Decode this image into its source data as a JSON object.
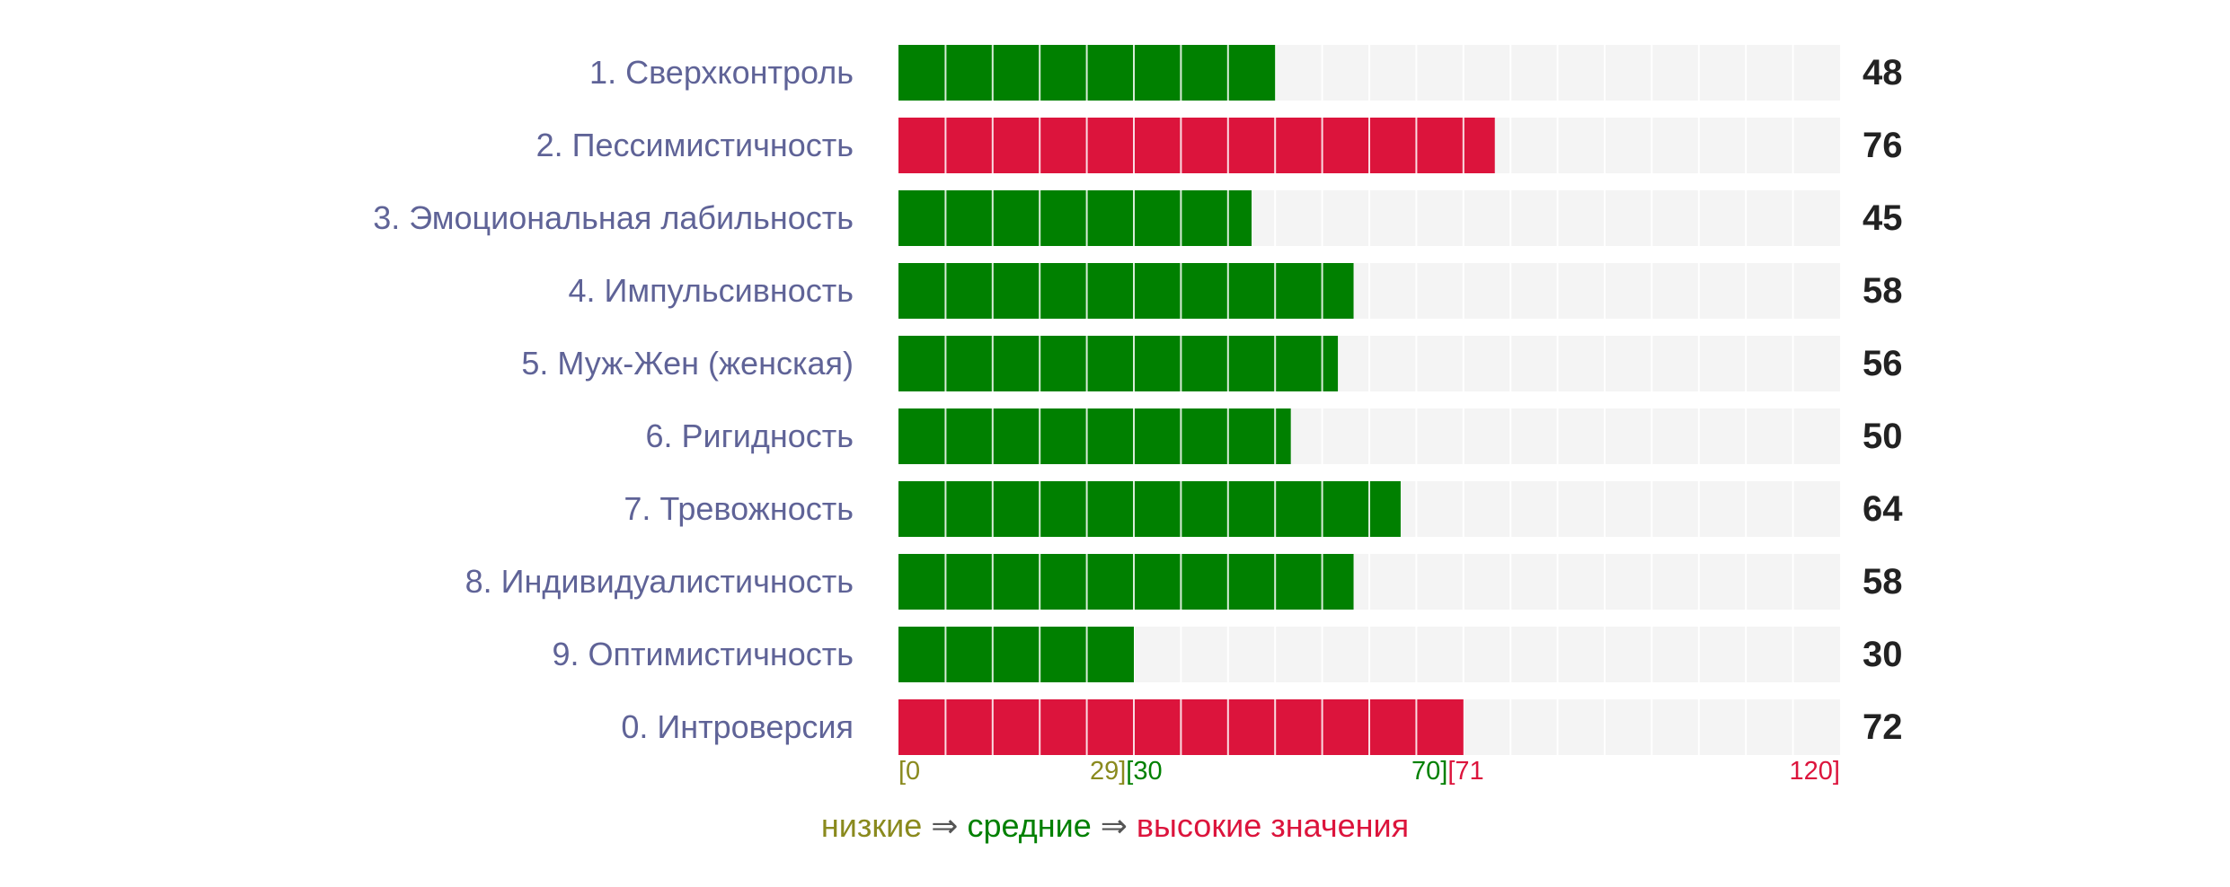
{
  "chart_data": {
    "type": "bar",
    "orientation": "horizontal",
    "categories": [
      "1. Сверхконтроль",
      "2. Пессимистичность",
      "3. Эмоциональная лабильность",
      "4. Импульсивность",
      "5. Муж-Жен (женская)",
      "6. Ригидность",
      "7. Тревожность",
      "8. Индивидуалистичность",
      "9. Оптимистичность",
      "0. Интроверсия"
    ],
    "values": [
      48,
      76,
      45,
      58,
      56,
      50,
      64,
      58,
      30,
      72
    ],
    "value_labels": [
      "48",
      "76",
      "45",
      "58",
      "56",
      "50",
      "64",
      "58",
      "30",
      "72"
    ],
    "xlim": [
      0,
      120
    ],
    "segment_size": 6,
    "ranges": [
      {
        "name": "низкие",
        "from": 0,
        "to": 29,
        "color": "#8a8a1e"
      },
      {
        "name": "средние",
        "from": 30,
        "to": 70,
        "color": "#008000"
      },
      {
        "name": "высокие",
        "from": 71,
        "to": 120,
        "color": "#dc143c"
      }
    ],
    "tick_labels": [
      {
        "text": "[0",
        "color": "#8a8a1e"
      },
      {
        "text": "29]",
        "color": "#8a8a1e"
      },
      {
        "text": "[30",
        "color": "#008000"
      },
      {
        "text": "70]",
        "color": "#008000"
      },
      {
        "text": "[71",
        "color": "#dc143c"
      },
      {
        "text": "120]",
        "color": "#dc143c"
      }
    ],
    "legend": {
      "low": "низкие",
      "arrow1": " ⇒ ",
      "mid": "средние",
      "arrow2": " ⇒ ",
      "high": "высокие значения"
    },
    "colors": {
      "low": "#8a8a1e",
      "mid": "#008000",
      "high": "#dc143c",
      "track": "#f4f4f4",
      "label": "#5f6397",
      "arrow": "#555555"
    }
  }
}
